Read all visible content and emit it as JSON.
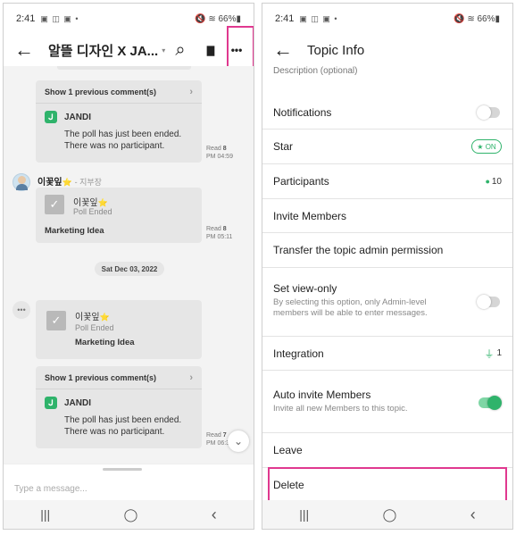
{
  "left": {
    "status": {
      "time": "2:41",
      "icons": "▣ ◫ ▣ •",
      "right": "🔇 ≋ 66%▮"
    },
    "header": {
      "back": "←",
      "title": "알뜰 디자인 X JA...",
      "caret": "▾",
      "search": "⌕",
      "file": "▇",
      "more": "•••"
    },
    "chat": {
      "card1": {
        "prev": "Show 1 previous comment(s)",
        "sender": "JANDI",
        "line1": "The poll has just been ended.",
        "line2": "There was no participant.",
        "read_label": "Read",
        "read_count": "8",
        "time": "PM 04:59"
      },
      "msg2": {
        "name": "이꽃잎",
        "star": "⭐",
        "role": "- 지부장",
        "poll_name": "이꽃잎",
        "poll_status": "Poll Ended",
        "poll_title": "Marketing Idea",
        "read_label": "Read",
        "read_count": "8",
        "time": "PM 05:11"
      },
      "date": "Sat Dec 03, 2022",
      "msg3": {
        "poll_name": "이꽃잎",
        "poll_status": "Poll Ended",
        "poll_title": "Marketing Idea"
      },
      "card2": {
        "prev": "Show 1 previous comment(s)",
        "sender": "JANDI",
        "line1": "The poll has just been ended.",
        "line2": "There was no participant.",
        "read_label": "Read",
        "read_count": "7",
        "time": "PM 06:3"
      },
      "scroll_down": "⌄"
    },
    "composer": {
      "placeholder": "Type a message..."
    },
    "nav": {
      "recent": "|||",
      "home": "◯",
      "back": "‹"
    }
  },
  "right": {
    "status": {
      "time": "2:41",
      "icons": "▣ ◫ ▣ •",
      "right": "🔇 ≋ 66%▮"
    },
    "header": {
      "back": "←",
      "title": "Topic Info"
    },
    "description_label": "Description (optional)",
    "rows": {
      "notifications": "Notifications",
      "star": "Star",
      "star_badge": "★ ON",
      "participants": "Participants",
      "participants_count": "10",
      "invite": "Invite Members",
      "transfer": "Transfer the topic admin permission",
      "view_only": "Set view-only",
      "view_only_sub": "By selecting this option, only Admin-level members will be able to enter messages.",
      "integration": "Integration",
      "integration_count": "1",
      "auto_invite": "Auto invite Members",
      "auto_invite_sub": "Invite all new Members to this topic.",
      "leave": "Leave",
      "delete": "Delete"
    },
    "toggles": {
      "notifications": false,
      "view_only": false,
      "auto_invite": true
    },
    "nav": {
      "recent": "|||",
      "home": "◯",
      "back": "‹"
    }
  },
  "colors": {
    "accent": "#2fb36b",
    "highlight": "#e0388f"
  }
}
